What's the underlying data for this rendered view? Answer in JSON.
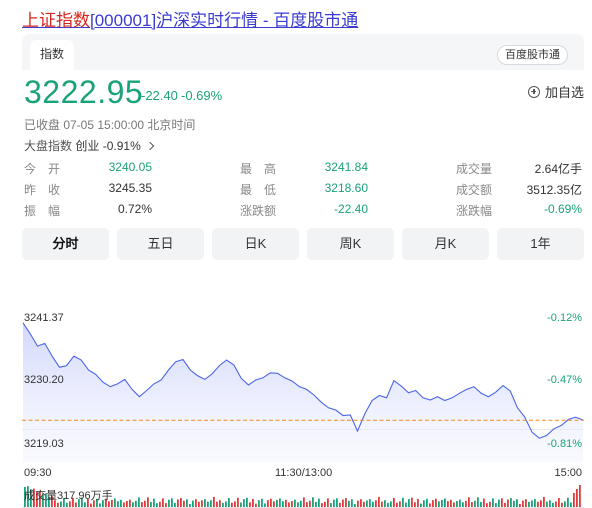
{
  "page_title": {
    "highlight": "上证指数",
    "rest": "[000001]沪深实时行情 - 百度股市通"
  },
  "tabs": {
    "active": "指数"
  },
  "brand_badge": "百度股市通",
  "quote": {
    "price": "3222.95",
    "change": "-22.40",
    "change_pct": "-0.69%",
    "add_favorite": "加自选",
    "status": "已收盘  07-05 15:00:00  北京时间",
    "market_label": "大盘指数",
    "market_name": "创业",
    "market_pct": "-0.91%"
  },
  "stats": [
    [
      {
        "l": "今　开",
        "v": "3240.05"
      },
      {
        "l": "最　高",
        "v": "3241.84"
      },
      {
        "l": "成交量",
        "v": "2.64亿手"
      }
    ],
    [
      {
        "l": "昨　收",
        "v": "3245.35"
      },
      {
        "l": "最　低",
        "v": "3218.60"
      },
      {
        "l": "成交额",
        "v": "3512.35亿"
      }
    ],
    [
      {
        "l": "振　幅",
        "v": "0.72%"
      },
      {
        "l": "涨跌额",
        "v": "-22.40"
      },
      {
        "l": "涨跌幅",
        "v": "-0.69%"
      }
    ]
  ],
  "periods": [
    "分时",
    "五日",
    "日K",
    "周K",
    "月K",
    "1年"
  ],
  "active_period": "分时",
  "chart": {
    "y_left": [
      "3241.37",
      "3230.20",
      "3219.03"
    ],
    "y_right": [
      "-0.12%",
      "-0.47%",
      "-0.81%"
    ],
    "x_labels": [
      "09:30",
      "11:30/13:00",
      "15:00"
    ],
    "volume_label": "成交量317.96万手"
  },
  "chart_data": {
    "type": "area",
    "title": "",
    "ylim": [
      3219.03,
      3241.37
    ],
    "reference_line": 3222.95,
    "prices": [
      3240.5,
      3238.5,
      3236.3,
      3236.8,
      3234.5,
      3232.5,
      3232.8,
      3234.5,
      3233.8,
      3232.0,
      3231.2,
      3229.8,
      3229.0,
      3229.5,
      3230.3,
      3228.5,
      3227.2,
      3228.3,
      3229.5,
      3230.2,
      3232.0,
      3233.5,
      3233.9,
      3232.0,
      3231.0,
      3230.3,
      3231.3,
      3232.8,
      3233.8,
      3232.9,
      3230.5,
      3229.3,
      3230.2,
      3230.6,
      3231.5,
      3231.4,
      3230.6,
      3230.0,
      3229.0,
      3228.5,
      3227.5,
      3226.2,
      3225.2,
      3224.8,
      3223.8,
      3223.9,
      3221.0,
      3224.1,
      3226.5,
      3227.4,
      3227.0,
      3230.1,
      3229.1,
      3227.9,
      3228.3,
      3227.0,
      3226.6,
      3227.2,
      3226.5,
      3227.0,
      3227.8,
      3228.5,
      3229.0,
      3227.8,
      3227.2,
      3228.0,
      3229.2,
      3228.2,
      3225.2,
      3223.5,
      3220.8,
      3219.7,
      3220.2,
      3221.4,
      3222.0,
      3223.1,
      3223.5,
      3223.0
    ],
    "volume_colors": [
      "#1aa37a",
      "#e03c3c"
    ]
  }
}
